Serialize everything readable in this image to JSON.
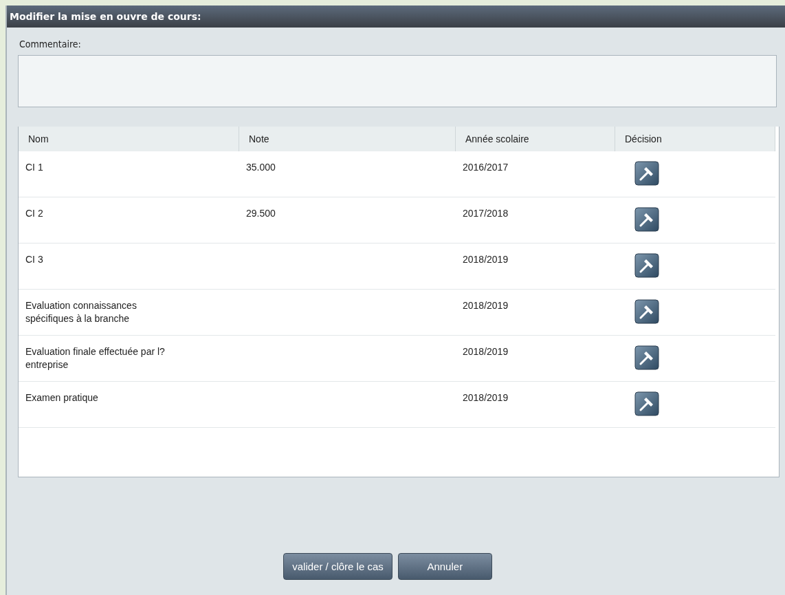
{
  "window": {
    "title": "Modifier la mise en ouvre de cours:"
  },
  "comment": {
    "label": "Commentaire:"
  },
  "table": {
    "columns": [
      "Nom",
      "Note",
      "Année scolaire",
      "Décision"
    ],
    "rows": [
      {
        "name": "CI 1",
        "note": "35.000",
        "year": "2016/2017"
      },
      {
        "name": "CI 2",
        "note": "29.500",
        "year": "2017/2018"
      },
      {
        "name": "CI 3",
        "year": "2018/2019"
      },
      {
        "name": "Evaluation connaissances spécifiques à la branche",
        "year": "2018/2019"
      },
      {
        "name": "Evaluation finale effectuée par l? entreprise",
        "year": "2018/2019"
      },
      {
        "name": "Examen pratique",
        "year": "2018/2019"
      }
    ]
  },
  "buttons": [
    "valider / clôre le cas",
    "Annuler"
  ]
}
